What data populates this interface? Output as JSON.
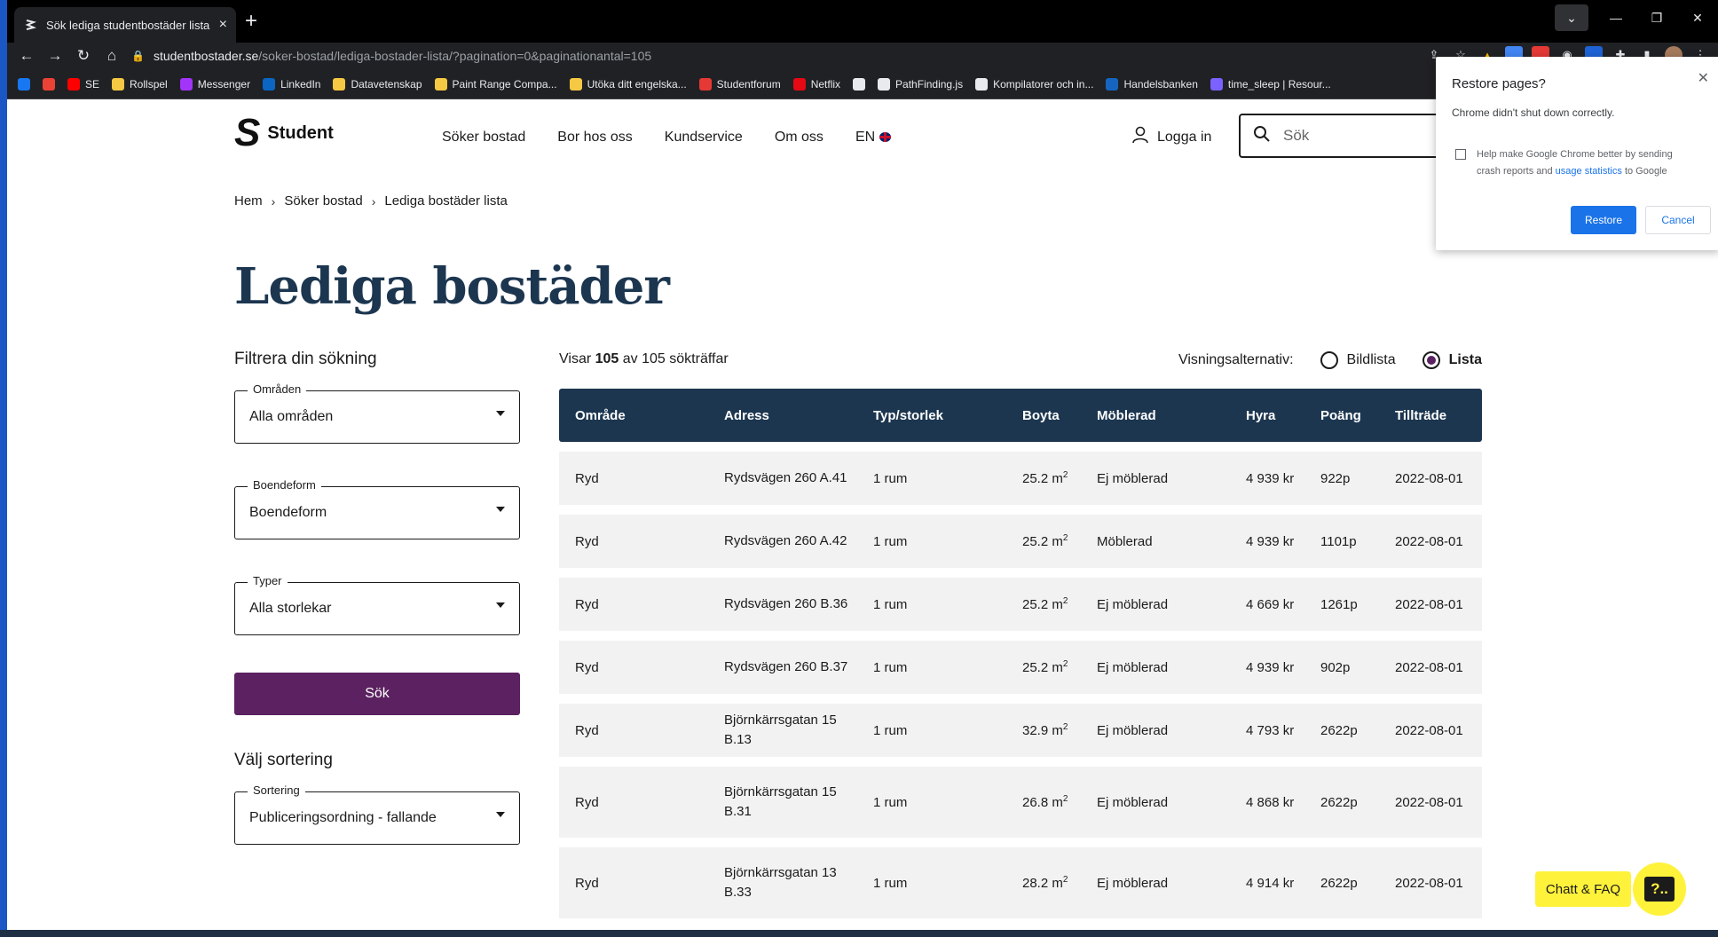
{
  "browser": {
    "tab_title": "Sök lediga studentbostäder lista",
    "tab_close": "×",
    "new_tab": "+",
    "url_host": "studentbostader.se",
    "url_path": "/soker-bostad/lediga-bostader-lista/?pagination=0&paginationantal=105",
    "bookmarks": [
      {
        "label": "",
        "color": "#1877f2"
      },
      {
        "label": "",
        "color": "#ea4335"
      },
      {
        "label": "SE",
        "color": "#ff0000"
      },
      {
        "label": "Rollspel",
        "color": "#f6c944"
      },
      {
        "label": "Messenger",
        "color": "#a334fa"
      },
      {
        "label": "LinkedIn",
        "color": "#0a66c2"
      },
      {
        "label": "Datavetenskap",
        "color": "#f6c944"
      },
      {
        "label": "Paint Range Compa...",
        "color": "#f6c944"
      },
      {
        "label": "Utöka ditt engelska...",
        "color": "#f6c944"
      },
      {
        "label": "Studentforum",
        "color": "#e53935"
      },
      {
        "label": "Netflix",
        "color": "#e50914"
      },
      {
        "label": "",
        "color": "#e8eaed"
      },
      {
        "label": "PathFinding.js",
        "color": "#e8eaed"
      },
      {
        "label": "Kompilatorer och in...",
        "color": "#e8eaed"
      },
      {
        "label": "Handelsbanken",
        "color": "#1565c0"
      },
      {
        "label": "time_sleep | Resour...",
        "color": "#7b61ff"
      }
    ]
  },
  "site": {
    "logo_mark": "S",
    "logo_text": "Student",
    "nav": [
      "Söker bostad",
      "Bor hos oss",
      "Kundservice",
      "Om oss",
      "EN"
    ],
    "login": "Logga in",
    "search_placeholder": "Sök",
    "breadcrumb": [
      "Hem",
      "Söker bostad",
      "Lediga bostäder lista"
    ],
    "heading": "Lediga bostäder"
  },
  "filters": {
    "title": "Filtrera din sökning",
    "areas": {
      "label": "Områden",
      "value": "Alla områden"
    },
    "housing": {
      "label": "Boendeform",
      "value": "Boendeform"
    },
    "types": {
      "label": "Typer",
      "value": "Alla storlekar"
    },
    "search_button": "Sök",
    "sort_title": "Välj sortering",
    "sort": {
      "label": "Sortering",
      "value": "Publiceringsordning - fallande"
    }
  },
  "results": {
    "count_prefix": "Visar",
    "count_shown": "105",
    "count_suffix": "av 105 sökträffar",
    "view_label": "Visningsalternativ:",
    "view_image": "Bildlista",
    "view_list": "Lista",
    "columns": [
      "Område",
      "Adress",
      "Typ/storlek",
      "Boyta",
      "Möblerad",
      "Hyra",
      "Poäng",
      "Tillträde"
    ],
    "rows": [
      {
        "area": "Ryd",
        "address": "Rydsvägen 260 A.41",
        "type": "1 rum",
        "size": "25.2 m",
        "furnished": "Ej möblerad",
        "rent": "4 939 kr",
        "points": "922p",
        "date": "2022-08-01"
      },
      {
        "area": "Ryd",
        "address": "Rydsvägen 260 A.42",
        "type": "1 rum",
        "size": "25.2 m",
        "furnished": "Möblerad",
        "rent": "4 939 kr",
        "points": "1101p",
        "date": "2022-08-01"
      },
      {
        "area": "Ryd",
        "address": "Rydsvägen 260 B.36",
        "type": "1 rum",
        "size": "25.2 m",
        "furnished": "Ej möblerad",
        "rent": "4 669 kr",
        "points": "1261p",
        "date": "2022-08-01"
      },
      {
        "area": "Ryd",
        "address": "Rydsvägen 260 B.37",
        "type": "1 rum",
        "size": "25.2 m",
        "furnished": "Ej möblerad",
        "rent": "4 939 kr",
        "points": "902p",
        "date": "2022-08-01"
      },
      {
        "area": "Ryd",
        "address": "Björnkärrsgatan 15 B.13",
        "type": "1 rum",
        "size": "32.9 m",
        "furnished": "Ej möblerad",
        "rent": "4 793 kr",
        "points": "2622p",
        "date": "2022-08-01"
      },
      {
        "area": "Ryd",
        "address": "Björnkärrsgatan 15 B.31",
        "type": "1 rum",
        "size": "26.8 m",
        "furnished": "Ej möblerad",
        "rent": "4 868 kr",
        "points": "2622p",
        "date": "2022-08-01"
      },
      {
        "area": "Ryd",
        "address": "Björnkärrsgatan 13 B.33",
        "type": "1 rum",
        "size": "28.2 m",
        "furnished": "Ej möblerad",
        "rent": "4 914 kr",
        "points": "2622p",
        "date": "2022-08-01"
      }
    ]
  },
  "restore_dialog": {
    "title": "Restore pages?",
    "message": "Chrome didn't shut down correctly.",
    "checkbox_text": "Help make Google Chrome better by sending crash reports and",
    "checkbox_link": "usage statistics",
    "checkbox_tail": "to Google",
    "restore": "Restore",
    "cancel": "Cancel"
  },
  "chat": {
    "label": "Chatt & FAQ",
    "icon_text": "?.."
  }
}
